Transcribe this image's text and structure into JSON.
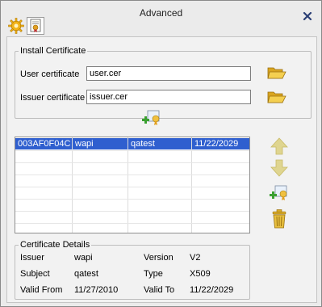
{
  "window": {
    "title": "Advanced"
  },
  "toolbar": {
    "settings_icon": "gear-icon",
    "certificate_icon": "certificate-icon"
  },
  "install": {
    "legend": "Install Certificate",
    "user_label": "User certificate",
    "user_value": "user.cer",
    "issuer_label": "Issuer certificate",
    "issuer_value": "issuer.cer"
  },
  "certificates": {
    "rows": [
      [
        "003AF0F04C",
        "wapi",
        "qatest",
        "11/22/2029"
      ]
    ]
  },
  "details": {
    "legend": "Certificate Details",
    "issuer_label": "Issuer",
    "issuer_value": "wapi",
    "version_label": "Version",
    "version_value": "V2",
    "subject_label": "Subject",
    "subject_value": "qatest",
    "type_label": "Type",
    "type_value": "X509",
    "valid_from_label": "Valid From",
    "valid_from_value": "11/27/2010",
    "valid_to_label": "Valid To",
    "valid_to_value": "11/22/2029"
  },
  "colors": {
    "selection": "#2f5fcf",
    "folder": "#e8c040",
    "arrow": "#dccd7a",
    "trash": "#c9a020"
  }
}
